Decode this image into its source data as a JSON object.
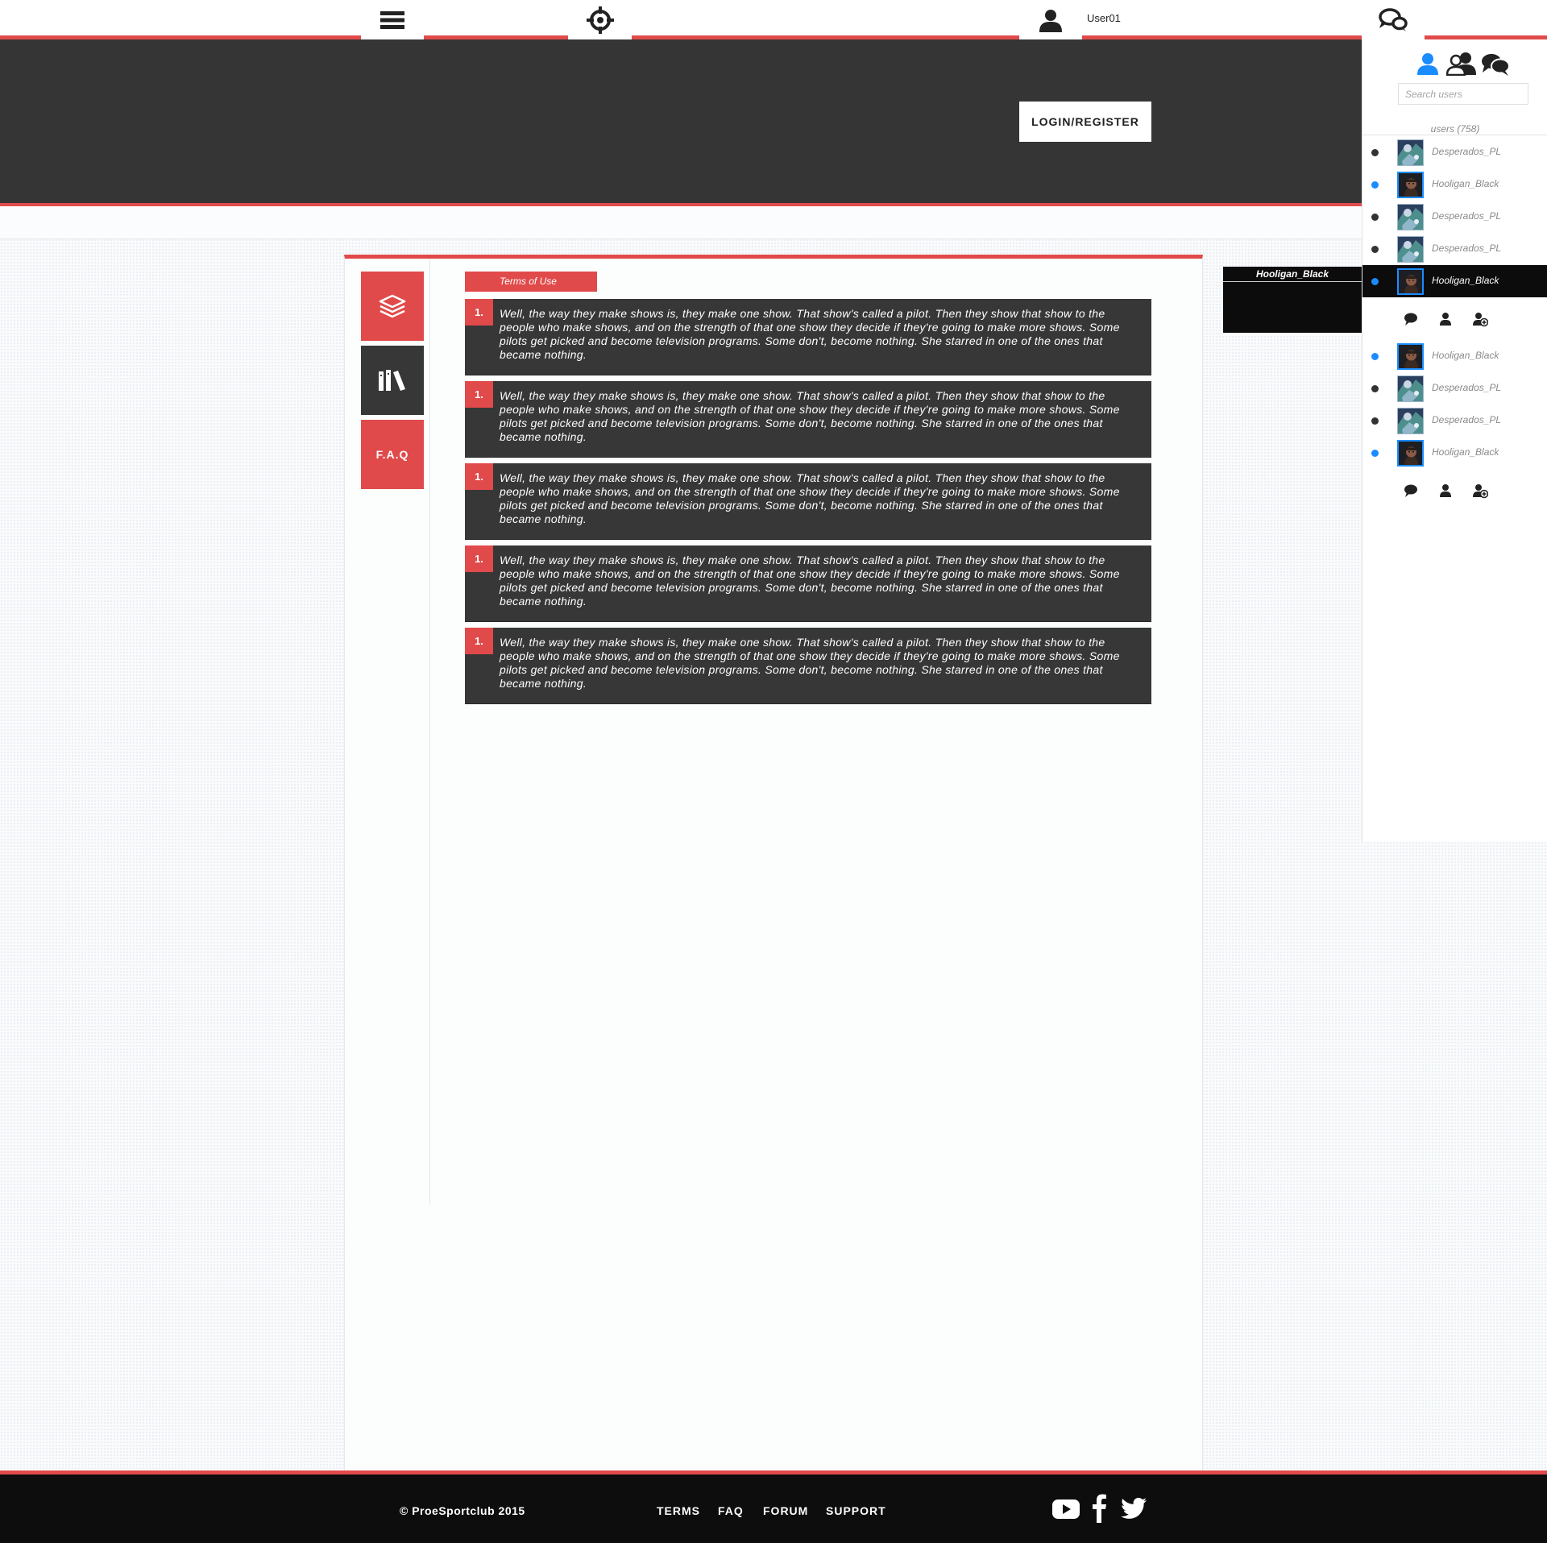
{
  "header": {
    "username": "User01",
    "login_label": "LOGIN/REGISTER"
  },
  "sidebar": {
    "faq_label": "F.A.Q"
  },
  "content": {
    "tab_label": "Terms of Use",
    "rules": [
      {
        "num": "1.",
        "text": "Well, the way they make shows is, they make one show. That show's called a pilot. Then they show that show to the people who make shows, and on the strength of that one show they decide if they're going to make more shows. Some pilots get picked and become television programs. Some don't, become nothing. She starred in one of the ones that became nothing."
      },
      {
        "num": "1.",
        "text": "Well, the way they make shows is, they make one show. That show's called a pilot. Then they show that show to the people who make shows, and on the strength of that one show they decide if they're going to make more shows. Some pilots get picked and become television programs. Some don't, become nothing. She starred in one of the ones that became nothing."
      },
      {
        "num": "1.",
        "text": "Well, the way they make shows is, they make one show. That show's called a pilot. Then they show that show to the people who make shows, and on the strength of that one show they decide if they're going to make more shows. Some pilots get picked and become television programs. Some don't, become nothing. She starred in one of the ones that became nothing."
      },
      {
        "num": "1.",
        "text": "Well, the way they make shows is, they make one show. That show's called a pilot. Then they show that show to the people who make shows, and on the strength of that one show they decide if they're going to make more shows. Some pilots get picked and become television programs. Some don't, become nothing. She starred in one of the ones that became nothing."
      },
      {
        "num": "1.",
        "text": "Well, the way they make shows is, they make one show. That show's called a pilot. Then they show that show to the people who make shows, and on the strength of that one show they decide if they're going to make more shows. Some pilots get picked and become television programs. Some don't, become nothing. She starred in one of the ones that became nothing."
      }
    ]
  },
  "popup": {
    "username": "Hooligan_Black"
  },
  "users_panel": {
    "search_placeholder": "Search users",
    "count_label": "users (758)",
    "users": [
      {
        "name": "Desperados_PL",
        "status": "offline",
        "avatar": "desperados",
        "selected": false
      },
      {
        "name": "Hooligan_Black",
        "status": "online",
        "avatar": "hooligan",
        "selected": false
      },
      {
        "name": "Desperados_PL",
        "status": "offline",
        "avatar": "desperados",
        "selected": false
      },
      {
        "name": "Desperados_PL",
        "status": "offline",
        "avatar": "desperados",
        "selected": false
      },
      {
        "name": "Hooligan_Black",
        "status": "online",
        "avatar": "hooligan",
        "selected": true
      },
      {
        "name": "Hooligan_Black",
        "status": "online",
        "avatar": "hooligan",
        "selected": false
      },
      {
        "name": "Desperados_PL",
        "status": "offline",
        "avatar": "desperados",
        "selected": false
      },
      {
        "name": "Desperados_PL",
        "status": "offline",
        "avatar": "desperados",
        "selected": false
      },
      {
        "name": "Hooligan_Black",
        "status": "online",
        "avatar": "hooligan",
        "selected": false
      }
    ]
  },
  "footer": {
    "copyright": "© ProeSportclub 2015",
    "links": [
      "TERMS",
      "FAQ",
      "FORUM",
      "SUPPORT"
    ]
  },
  "colors": {
    "accent": "#e14a4a",
    "dark": "#353535",
    "online": "#1a8cff",
    "offline": "#333333"
  }
}
